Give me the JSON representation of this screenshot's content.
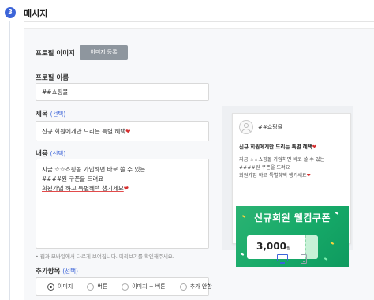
{
  "step": {
    "number": "3",
    "title": "메시지"
  },
  "form": {
    "profile_image": {
      "label": "프로필 이미지",
      "button": "이미지 등록"
    },
    "profile_name": {
      "label": "프로필 이름",
      "value": "##쇼핑몰"
    },
    "subject": {
      "label": "제목",
      "optional": "(선택)",
      "value": "신규 회원에게만 드리는 특별 혜택"
    },
    "content": {
      "label": "내용",
      "optional": "(선택)",
      "lines": [
        "지금 ☆☆쇼핑몰 가입하면 바로 쓸 수 있는",
        "####원 쿠폰을 드려요",
        "회원가입 하고 특별혜택 챙기세요"
      ],
      "help": "• 웹과 모바일에서 다르게 보여집니다. 미리보기를 확인해주세요."
    },
    "extra": {
      "label": "추가항목",
      "optional": "(선택)",
      "options": [
        "이미지",
        "버튼",
        "이미지 + 버튼",
        "추가 안함"
      ],
      "selected": "이미지"
    }
  },
  "preview": {
    "profile_name": "##쇼핑몰",
    "title": "신규 회원에게만 드리는 특별 혜택",
    "body": [
      "지금 ☆☆쇼핑몰 가입하면 바로 쓸 수 있는",
      "####원 쿠폰을 드려요",
      "회원가입 하고 특별혜택 챙기세요"
    ],
    "banner": {
      "title": "신규회원 웰컴쿠폰",
      "amount": "3,000",
      "unit": "원"
    },
    "devices": [
      "desktop-icon",
      "mobile-icon"
    ]
  },
  "colors": {
    "accent": "#3c64d8",
    "banner_green": "#16a968",
    "heart": "#d62f2f"
  }
}
